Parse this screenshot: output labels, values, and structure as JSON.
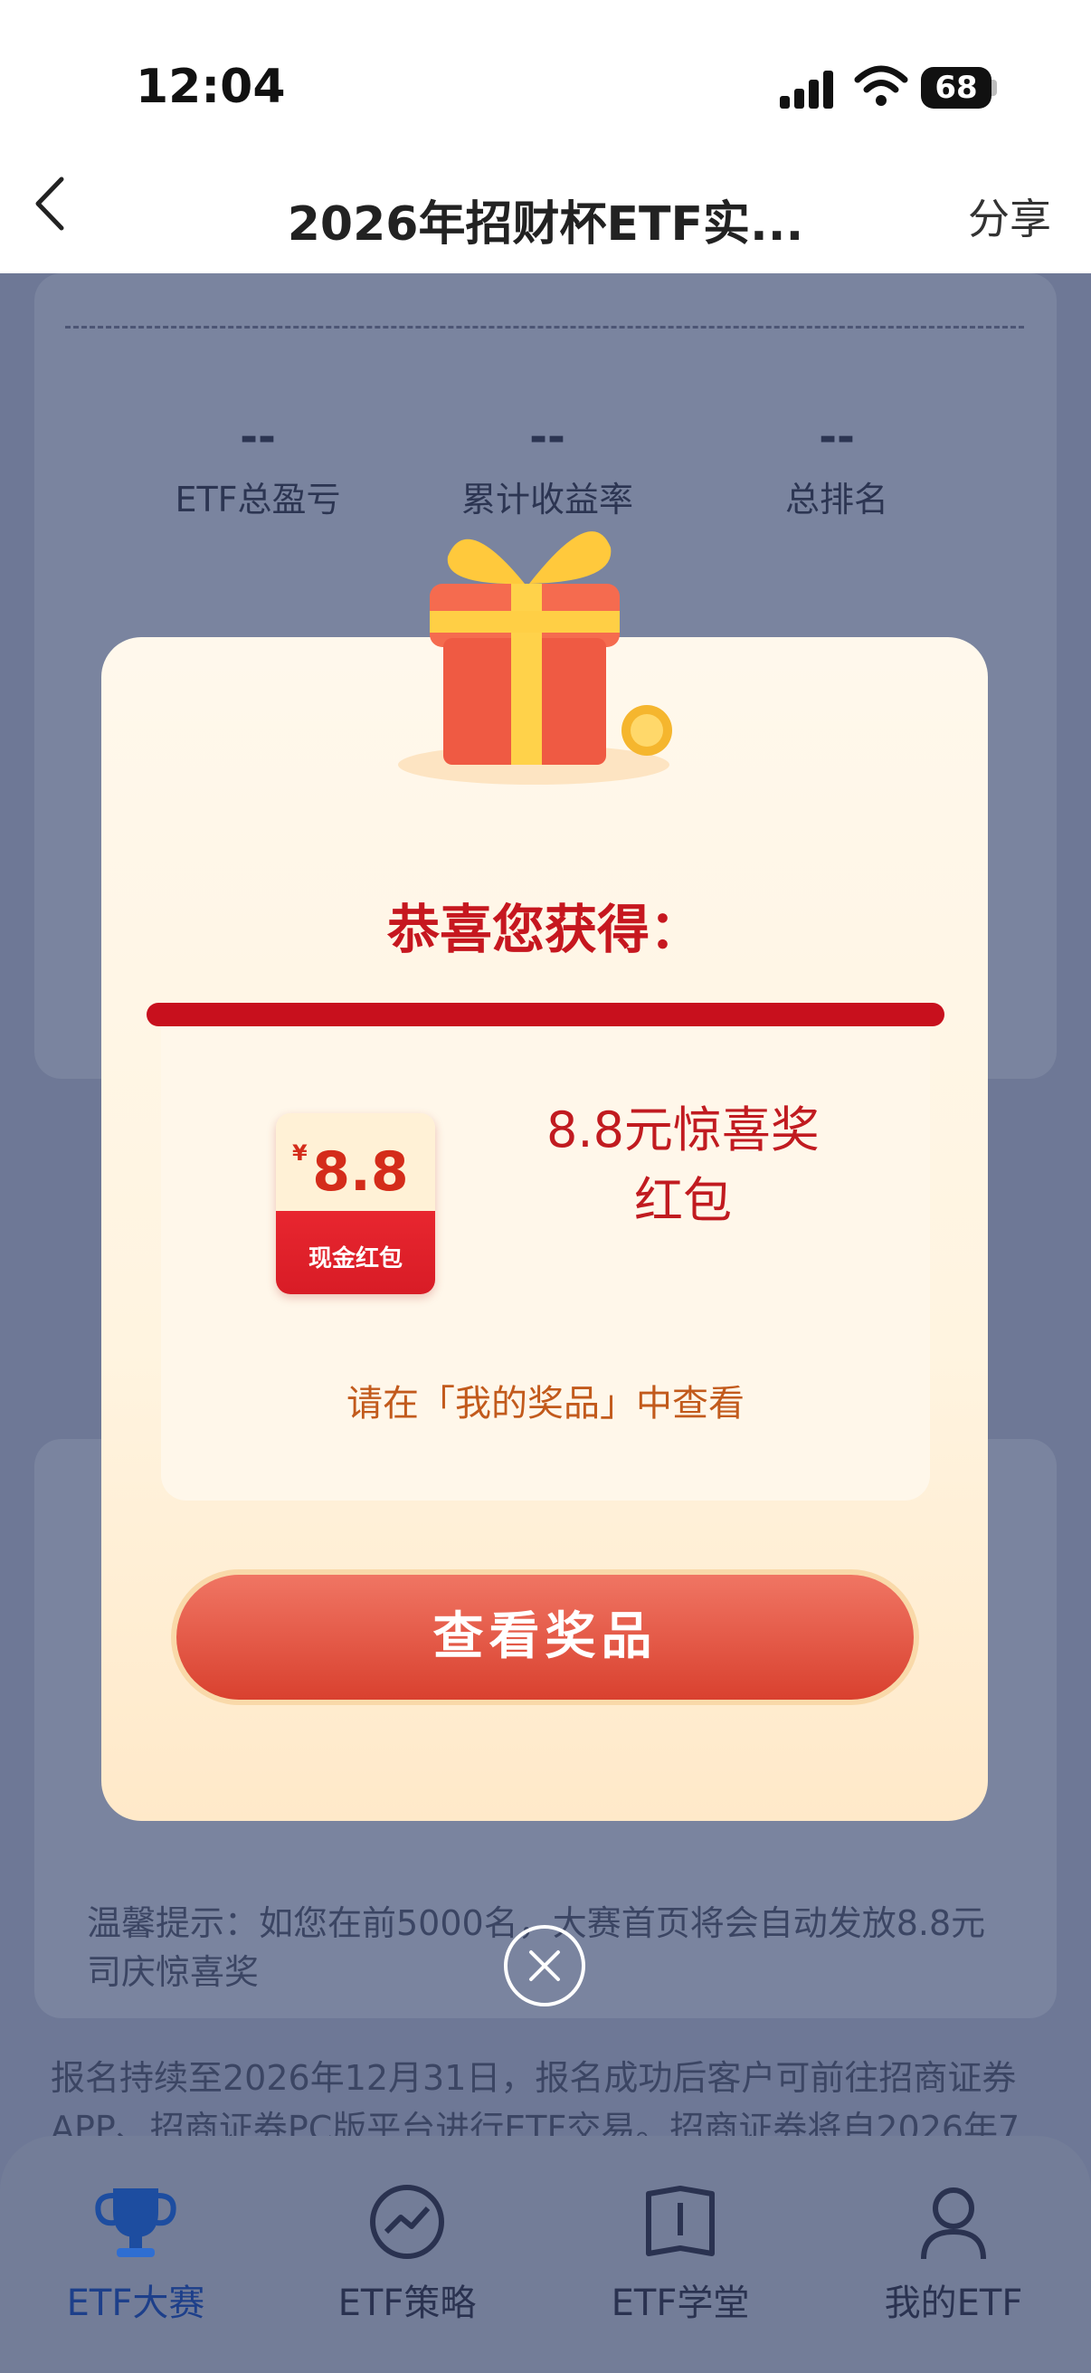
{
  "status_bar": {
    "time": "12:04",
    "battery": "68"
  },
  "nav": {
    "title": "2026年招财杯ETF实...",
    "share_label": "分享"
  },
  "background": {
    "stats": [
      {
        "value": "--",
        "label": "ETF总盈亏"
      },
      {
        "value": "--",
        "label": "累计收益率"
      },
      {
        "value": "--",
        "label": "总排名"
      }
    ],
    "tip_text": "温馨提示：如您在前5000名，大赛首页将会自动发放8.8元司庆惊喜奖",
    "info_text": "报名持续至2026年12月31日，报名成功后客户可前往招商证券APP、招商证券PC版平台进行ETF交易。招商证券将自2026年7"
  },
  "modal": {
    "heading": "恭喜您获得：",
    "envelope_amount": "8.8",
    "envelope_currency": "¥",
    "envelope_label": "现金红包",
    "prize_name_line1": "8.8元惊喜奖",
    "prize_name_line2": "红包",
    "hint": "请在「我的奖品」中查看",
    "button_label": "查看奖品"
  },
  "tabs": [
    {
      "label": "ETF大赛",
      "icon": "trophy-icon",
      "active": true
    },
    {
      "label": "ETF策略",
      "icon": "chart-trend-icon",
      "active": false
    },
    {
      "label": "ETF学堂",
      "icon": "book-icon",
      "active": false
    },
    {
      "label": "我的ETF",
      "icon": "user-icon",
      "active": false
    }
  ],
  "colors": {
    "accent_red": "#c6171f",
    "button_red": "#d9412f",
    "active_tab": "#1d3f8a",
    "overlay": "#6e7896"
  }
}
